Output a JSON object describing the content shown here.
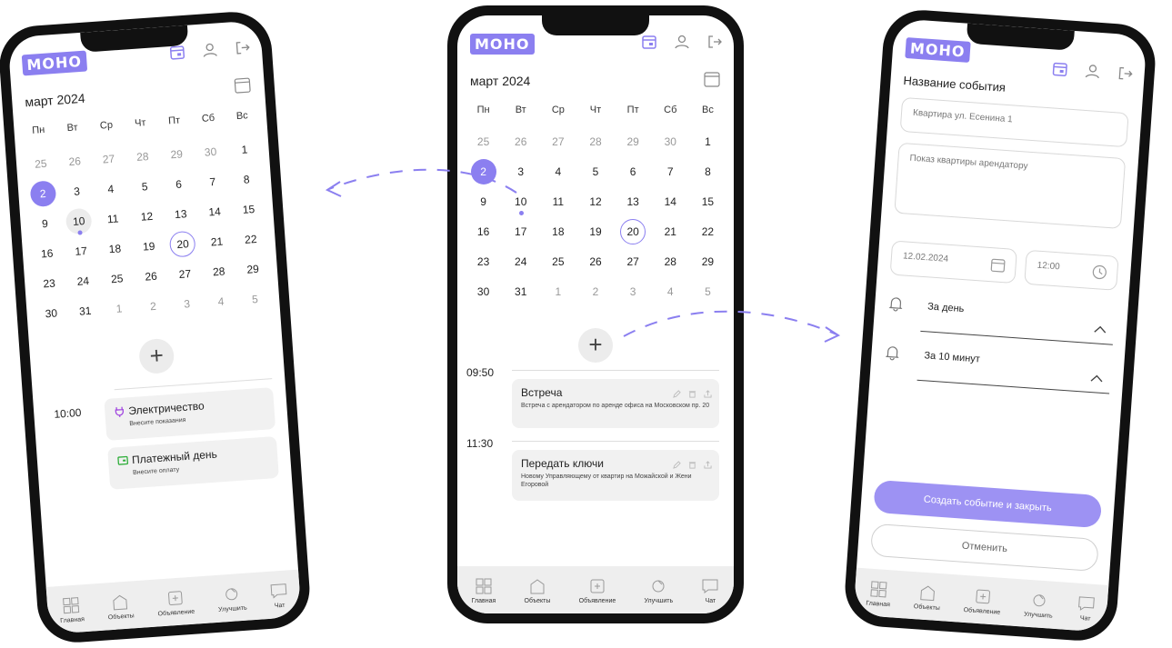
{
  "app": {
    "logo": "МОНО"
  },
  "calendar": {
    "month_label": "март 2024",
    "weekdays": [
      "Пн",
      "Вт",
      "Ср",
      "Чт",
      "Пт",
      "Сб",
      "Вс"
    ],
    "weeks": [
      [
        "25",
        "26",
        "27",
        "28",
        "29",
        "30",
        "1"
      ],
      [
        "2",
        "3",
        "4",
        "5",
        "6",
        "7",
        "8"
      ],
      [
        "9",
        "10",
        "11",
        "12",
        "13",
        "14",
        "15"
      ],
      [
        "16",
        "17",
        "18",
        "19",
        "20",
        "21",
        "22"
      ],
      [
        "23",
        "24",
        "25",
        "26",
        "27",
        "28",
        "29"
      ],
      [
        "30",
        "31",
        "1",
        "2",
        "3",
        "4",
        "5"
      ]
    ]
  },
  "left": {
    "time": "10:00",
    "events": [
      {
        "title": "Электричество",
        "desc": "Внесите показания"
      },
      {
        "title": "Платежный день",
        "desc": "Внесите оплату"
      }
    ]
  },
  "middle": {
    "slots": [
      {
        "time": "09:50",
        "title": "Встреча",
        "desc": "Встреча с арендатором по аренде офиса на Московском пр. 20"
      },
      {
        "time": "11:30",
        "title": "Передать ключи",
        "desc": "Новому Управляющему от квартир на Можайской и Жени Егоровой"
      }
    ]
  },
  "form": {
    "title": "Название события",
    "name_placeholder": "Квартира ул. Есенина 1",
    "desc_placeholder": "Показ квартиры арендатору",
    "date": "12.02.2024",
    "time": "12:00",
    "reminder1": "За день",
    "reminder2": "За 10 минут",
    "create_btn": "Создать событие и закрыть",
    "cancel_btn": "Отменить"
  },
  "nav": {
    "items": [
      "Главная",
      "Объекты",
      "Объявление",
      "Улучшить",
      "Чат"
    ]
  },
  "colors": {
    "accent": "#8b7ff0",
    "accent_light": "#9d92f3"
  }
}
